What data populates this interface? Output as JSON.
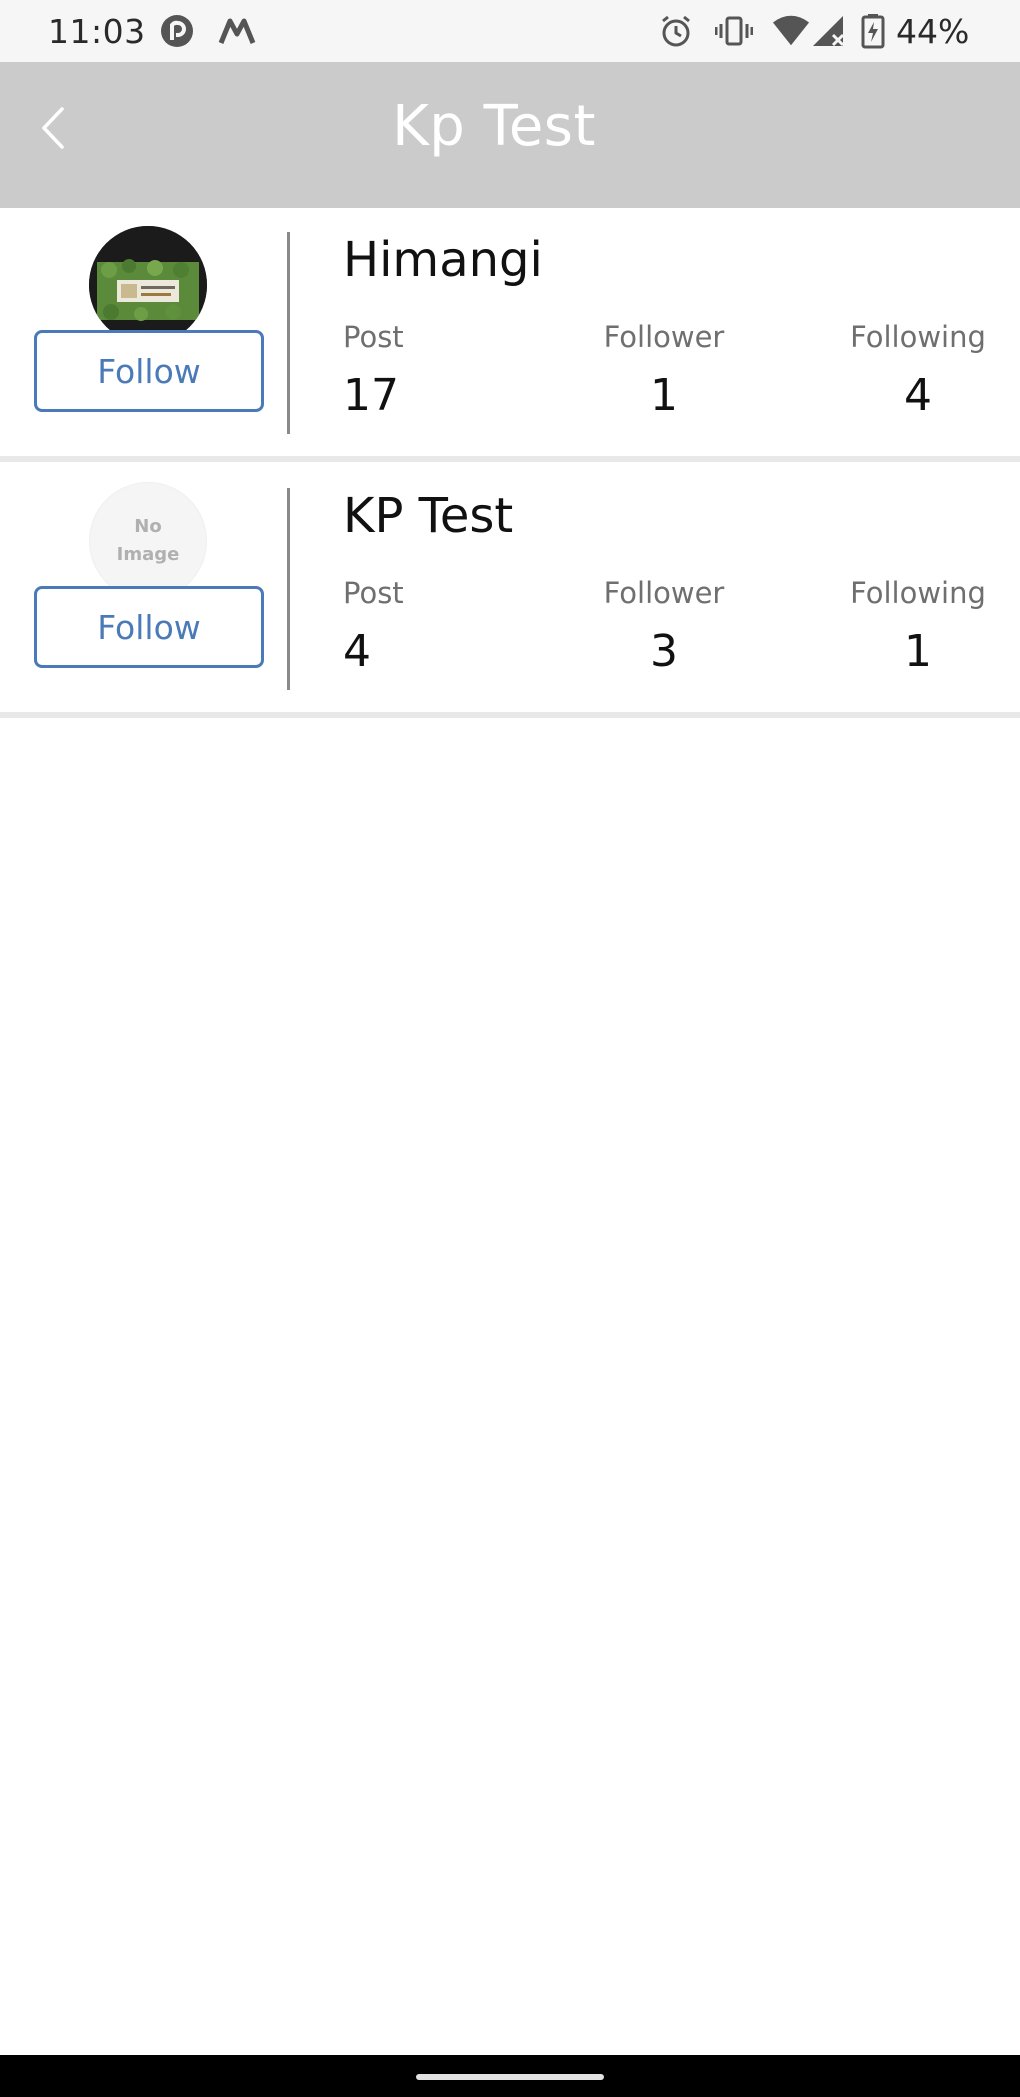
{
  "status_bar": {
    "time": "11:03",
    "battery": "44%",
    "left_icons": [
      "pocket-casts-icon",
      "mi-icon"
    ],
    "right_icons": [
      "alarm-icon",
      "vibrate-icon",
      "wifi-icon",
      "signal-icon",
      "battery-charging-icon"
    ]
  },
  "header": {
    "title": "Kp Test",
    "back_icon": "chevron-left-icon"
  },
  "users": [
    {
      "name": "Himangi",
      "avatar": "photo",
      "follow_label": "Follow",
      "post_label": "Post",
      "post_count": "17",
      "follower_label": "Follower",
      "follower_count": "1",
      "following_label": "Following",
      "following_count": "4"
    },
    {
      "name": "KP Test",
      "avatar": "placeholder",
      "avatar_text_line1": "No",
      "avatar_text_line2": "Image",
      "follow_label": "Follow",
      "post_label": "Post",
      "post_count": "4",
      "follower_label": "Follower",
      "follower_count": "3",
      "following_label": "Following",
      "following_count": "1"
    }
  ],
  "colors": {
    "accent": "#4a7ab8",
    "header_bg": "#cbcbcb",
    "divider": "#e8e8e8"
  }
}
